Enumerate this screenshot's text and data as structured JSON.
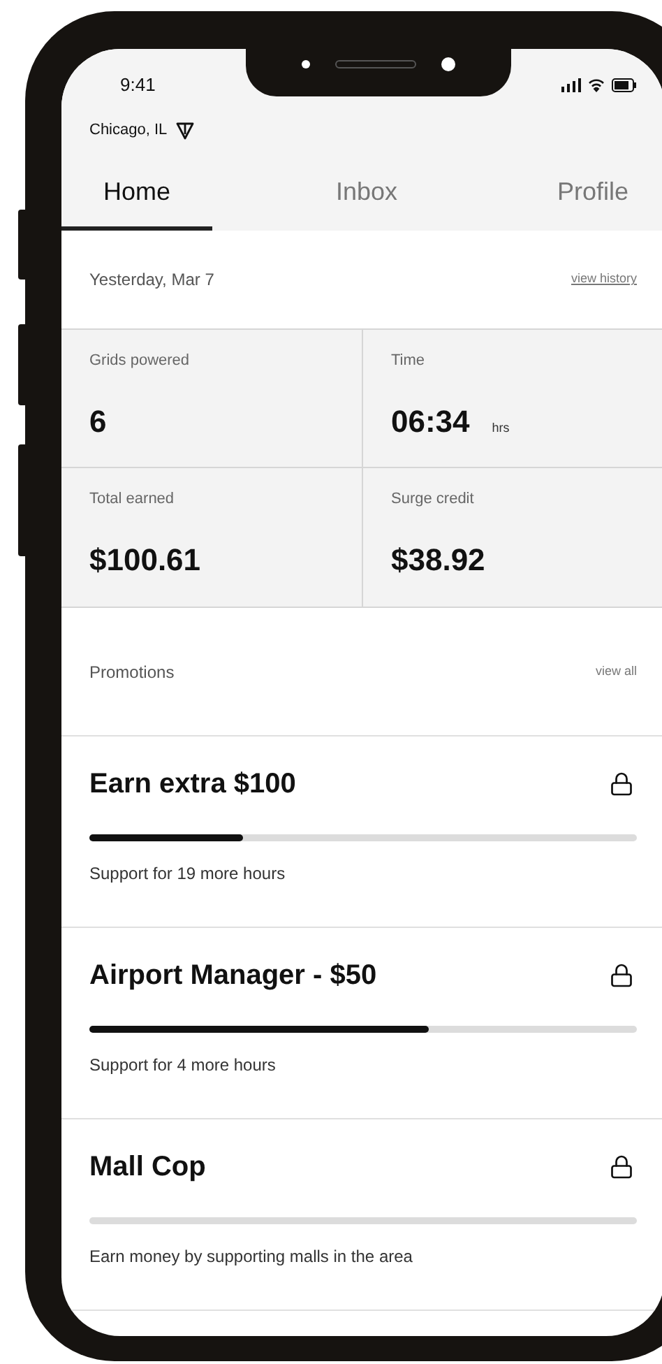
{
  "status_bar": {
    "time": "9:41"
  },
  "location": {
    "label": "Chicago, IL"
  },
  "tabs": [
    {
      "label": "Home",
      "selected": true
    },
    {
      "label": "Inbox",
      "selected": false
    },
    {
      "label": "Profile",
      "selected": false
    }
  ],
  "summary": {
    "date": "Yesterday, Mar 7",
    "link": "view history"
  },
  "stats": [
    {
      "label": "Grids powered",
      "value": "6"
    },
    {
      "label": "Time",
      "value": "06:34",
      "unit": "hrs"
    },
    {
      "label": "Total earned",
      "value": "$100.61"
    },
    {
      "label": "Surge credit",
      "value": "$38.92"
    }
  ],
  "promotions": {
    "title": "Promotions",
    "link": "view all",
    "items": [
      {
        "title": "Earn extra $100",
        "level": 0.28,
        "note": "Support for 19 more hours",
        "locked": true
      },
      {
        "title": "Airport Manager - $50",
        "level": 0.62,
        "note": "Support for 4 more hours",
        "locked": true
      },
      {
        "title": "Mall Cop",
        "note": "Earn money by supporting malls in the area",
        "locked": true
      }
    ]
  }
}
